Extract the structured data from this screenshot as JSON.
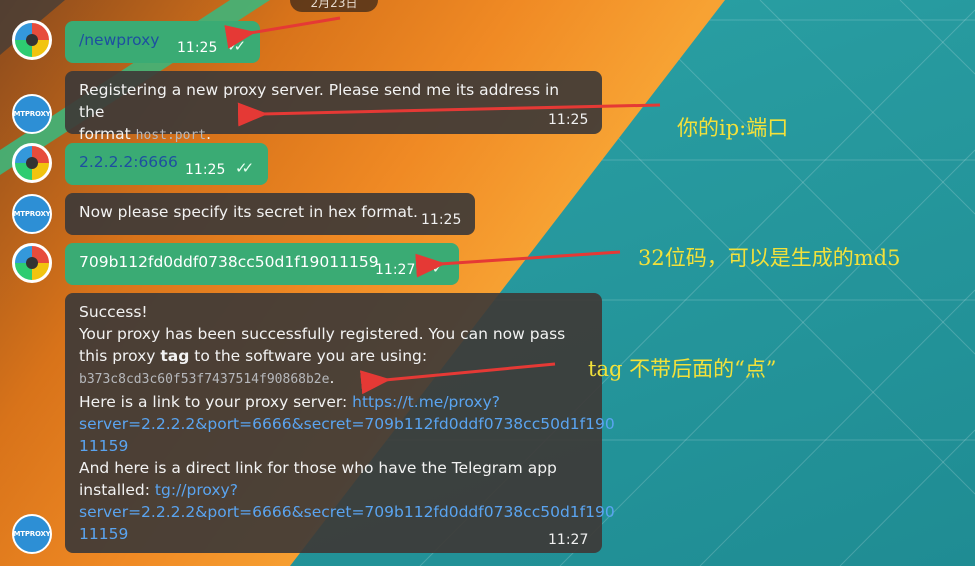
{
  "date_label": "2月23日",
  "messages": {
    "m1": {
      "text": "/newproxy",
      "time": "11:25"
    },
    "m2": {
      "line1": "Registering a new proxy server. Please send me its address in the",
      "line2a": "format ",
      "code": "host:port",
      "line2b": ".",
      "time": "11:25"
    },
    "m3": {
      "text": "2.2.2.2:6666",
      "time": "11:25"
    },
    "m4": {
      "text": "Now please specify its secret in hex format.",
      "time": "11:25"
    },
    "m5": {
      "text": "709b112fd0ddf0738cc50d1f19011159",
      "time": "11:27"
    },
    "m6": {
      "l1": "Success!",
      "l2": "Your proxy has been successfully registered. You can now pass",
      "l3a": "this proxy ",
      "l3b": "tag",
      "l3c": " to the software you are using:",
      "tag": "b373c8cd3c60f53f7437514f90868b2e",
      "tag_end": ".",
      "l5": "Here is a link to your proxy server: ",
      "link1a": "https://t.me/proxy?",
      "link1b": "server=2.2.2.2&port=6666&secret=709b112fd0ddf0738cc50d1f190",
      "link1c": "11159",
      "l8": "And here is a direct link for those who have the Telegram app",
      "l9": "installed: ",
      "link2a": "tg://proxy?",
      "link2b": "server=2.2.2.2&port=6666&secret=709b112fd0ddf0738cc50d1f190",
      "link2c": "11159",
      "time": "11:27"
    }
  },
  "avatars": {
    "bot_label": "MTPROXY"
  },
  "annotations": {
    "ip_port": "你的ip:端口",
    "secret": "32位码，可以是生成的md5",
    "tag": "tag  不带后面的“点”"
  },
  "colors": {
    "annotation": "#f3e13a",
    "arrow": "#e53935",
    "outgoing": "#3aab74",
    "link": "#5aa4f0"
  }
}
